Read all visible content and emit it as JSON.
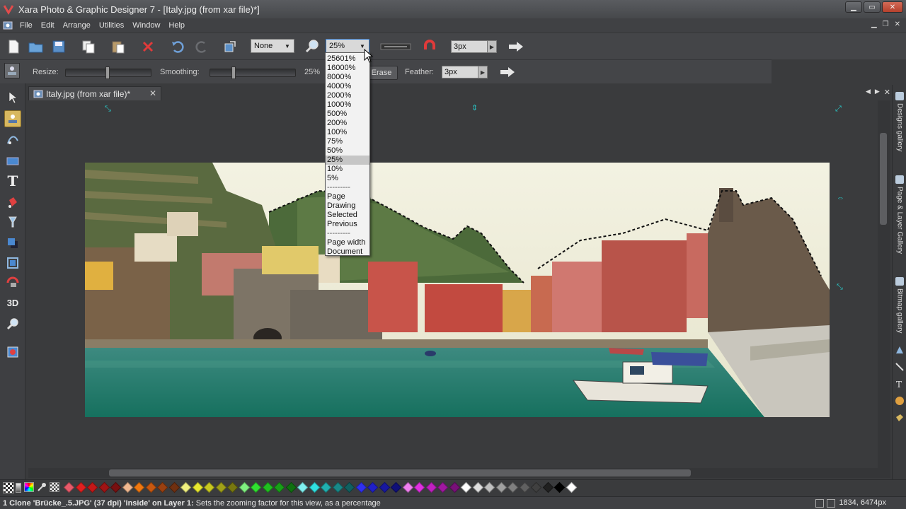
{
  "window": {
    "title": "Xara Photo & Graphic Designer 7 - [Italy.jpg  (from xar file)*]"
  },
  "menu": [
    "File",
    "Edit",
    "Arrange",
    "Utilities",
    "Window",
    "Help"
  ],
  "toolbar": {
    "quality_combo": "None",
    "zoom_combo": "25%",
    "width_field": "3px"
  },
  "infobar": {
    "resize_label": "Resize:",
    "smoothing_label": "Smoothing:",
    "smoothing_value": "25%",
    "erase_label": "Erase",
    "feather_label": "Feather:",
    "feather_value": "3px"
  },
  "document_tab": {
    "title": "Italy.jpg  (from xar file)*"
  },
  "zoom_dropdown": {
    "options": [
      "25601%",
      "16000%",
      "8000%",
      "4000%",
      "2000%",
      "1000%",
      "500%",
      "200%",
      "100%",
      "75%",
      "50%",
      "25%",
      "10%",
      "5%"
    ],
    "separator": "---------",
    "extra_options": [
      "Page",
      "Drawing",
      "Selected",
      "Previous"
    ],
    "extra_options2": [
      "Page width",
      "Document"
    ],
    "selected": "25%"
  },
  "side_panel": {
    "tabs": [
      "Designs gallery",
      "Page & Layer Gallery",
      "Bitmap gallery"
    ]
  },
  "statusbar": {
    "selection_info": "1 Clone 'Brücke_.5.JPG' (37 dpi) 'inside' on Layer 1:",
    "hint": " Sets the zooming factor for this view, as a percentage",
    "coords": "1834, 6474px"
  },
  "colors": {
    "accent": "#d8b860",
    "handle": "#29c9c9",
    "close_button": "#c4503b",
    "palette": [
      "#e85a6a",
      "#e02020",
      "#c41818",
      "#a01414",
      "#781010",
      "#f0b890",
      "#f07810",
      "#c85810",
      "#9a4010",
      "#703010",
      "#f0f080",
      "#e8e830",
      "#c8c820",
      "#a0a018",
      "#787810",
      "#80f080",
      "#30e030",
      "#20c020",
      "#18a018",
      "#107010",
      "#80f0f0",
      "#30e0e0",
      "#20b0b0",
      "#188888",
      "#106060",
      "#3030f0",
      "#2020c8",
      "#1818a0",
      "#101078",
      "#f080f0",
      "#e030e0",
      "#c020c0",
      "#a018a0",
      "#781078",
      "#ffffff",
      "#e0e0e0",
      "#c0c0c0",
      "#a0a0a0",
      "#808080",
      "#606060",
      "#404040",
      "#202020",
      "#000000",
      "#ffffff"
    ]
  }
}
